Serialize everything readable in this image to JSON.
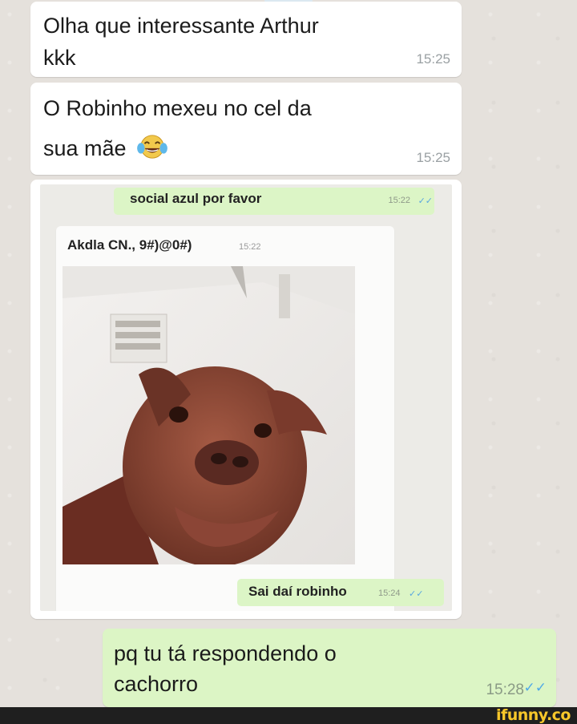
{
  "messages": [
    {
      "text_l1": "Olha que interessante Arthur",
      "text_l2": "kkk",
      "time": "15:25"
    },
    {
      "text_l1": "O Robinho mexeu no cel da",
      "text_l2": "sua mãe",
      "emoji": "face-with-tears-of-joy-icon",
      "time": "15:25"
    },
    {
      "embedded_screenshot": {
        "top_message": {
          "text": "social azul por favor",
          "time": "15:22",
          "ticks": "✓✓"
        },
        "incoming": {
          "text": "Akdla CN., 9#)@0#)",
          "time": "15:22",
          "photo": "dog-photo"
        },
        "reply": {
          "text": "Sai daí robinho",
          "time": "15:24",
          "ticks": "✓✓"
        }
      }
    },
    {
      "text_l1": "pq tu tá respondendo o",
      "text_l2": "cachorro",
      "time": "15:28",
      "ticks": "✓✓",
      "outgoing": true
    }
  ],
  "watermark": "ifunny.co",
  "colors": {
    "outgoing_bubble": "#dcf5c5",
    "incoming_bubble": "#ffffff",
    "tick_blue": "#4fa9e7",
    "brand": "#f7c72a"
  }
}
